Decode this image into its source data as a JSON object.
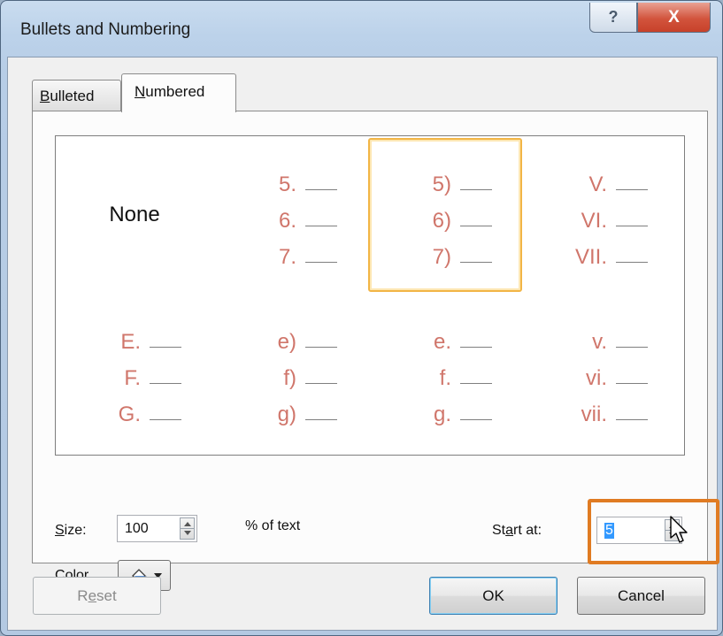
{
  "window": {
    "title": "Bullets and Numbering",
    "help_glyph": "?",
    "close_glyph": "X"
  },
  "tabs": [
    {
      "label_first": "B",
      "label_rest": "ulleted",
      "active": false
    },
    {
      "label_first": "N",
      "label_rest": "umbered",
      "active": true
    }
  ],
  "gallery": {
    "none_label": "None",
    "selected_index": 2,
    "row1": [
      {
        "items": []
      },
      {
        "items": [
          "5.",
          "6.",
          "7."
        ]
      },
      {
        "items": [
          "5)",
          "6)",
          "7)"
        ]
      },
      {
        "items": [
          "V.",
          "VI.",
          "VII."
        ]
      }
    ],
    "row2": [
      {
        "items": [
          "E.",
          "F.",
          "G."
        ]
      },
      {
        "items": [
          "e)",
          "f)",
          "g)"
        ]
      },
      {
        "items": [
          "e.",
          "f.",
          "g."
        ]
      },
      {
        "items": [
          "v.",
          "vi.",
          "vii."
        ]
      }
    ]
  },
  "size": {
    "label_first": "S",
    "label_rest": "ize:",
    "value": "100",
    "suffix": "% of text"
  },
  "color": {
    "label_first": "C",
    "label_rest": "olor",
    "swatch": "#c0504d",
    "icon": "paint-bucket-icon"
  },
  "start_at": {
    "label_pre": "St",
    "label_u": "a",
    "label_post": "rt at:",
    "value": "5",
    "highlight_color": "#e07b22"
  },
  "buttons": {
    "reset_pre": "R",
    "reset_u": "e",
    "reset_post": "set",
    "ok": "OK",
    "cancel": "Cancel"
  },
  "colors": {
    "number_color": "#d0766b",
    "selection_border": "#f2b545"
  }
}
